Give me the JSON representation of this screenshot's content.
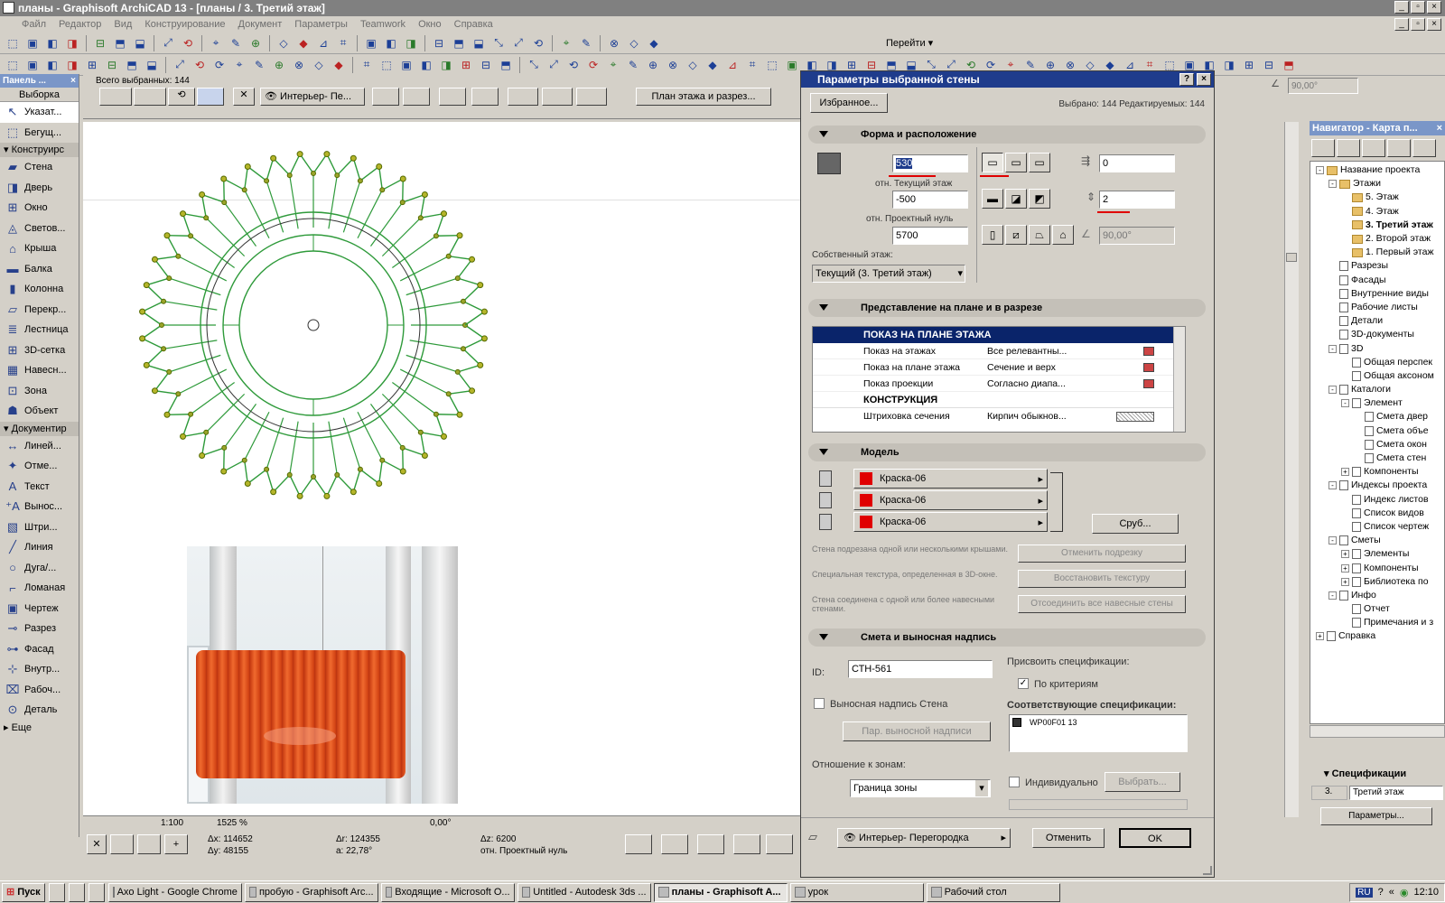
{
  "window": {
    "title": "планы - Graphisoft ArchiCAD 13 - [планы / 3. Третий этаж]"
  },
  "menu": [
    "Файл",
    "Редактор",
    "Вид",
    "Конструирование",
    "Документ",
    "Параметры",
    "Teamwork",
    "Окно",
    "Справка"
  ],
  "toolbar": {
    "goto_label": "Перейти"
  },
  "info_box": {
    "selected_total": "Всего выбранных: 144",
    "view_mode": "Интерьер- Пе...",
    "plan_section": "План этажа и разрез...",
    "angle_value": "90,00°"
  },
  "palette": {
    "title": "Панель ...",
    "tab": "Выборка",
    "items_top": [
      {
        "label": "Указат...",
        "icon": "arrow-icon"
      },
      {
        "label": "Бегущ...",
        "icon": "marquee-icon"
      }
    ],
    "section1": "Конструирс",
    "items_construct": [
      {
        "label": "Стена",
        "icon": "wall-icon"
      },
      {
        "label": "Дверь",
        "icon": "door-icon"
      },
      {
        "label": "Окно",
        "icon": "window-icon"
      },
      {
        "label": "Светов...",
        "icon": "skylight-icon"
      },
      {
        "label": "Крыша",
        "icon": "roof-icon"
      },
      {
        "label": "Балка",
        "icon": "beam-icon"
      },
      {
        "label": "Колонна",
        "icon": "column-icon"
      },
      {
        "label": "Перекр...",
        "icon": "slab-icon"
      },
      {
        "label": "Лестница",
        "icon": "stair-icon"
      },
      {
        "label": "3D-сетка",
        "icon": "mesh-icon"
      },
      {
        "label": "Навесн...",
        "icon": "curtain-wall-icon"
      },
      {
        "label": "Зона",
        "icon": "zone-icon"
      },
      {
        "label": "Объект",
        "icon": "object-icon"
      }
    ],
    "section2": "Документир",
    "items_doc": [
      {
        "label": "Линей...",
        "icon": "dimension-icon"
      },
      {
        "label": "Отме...",
        "icon": "level-icon"
      },
      {
        "label": "Текст",
        "icon": "text-icon"
      },
      {
        "label": "Вынос...",
        "icon": "label-icon"
      },
      {
        "label": "Штри...",
        "icon": "fill-icon"
      },
      {
        "label": "Линия",
        "icon": "line-icon"
      },
      {
        "label": "Дуга/...",
        "icon": "arc-icon"
      },
      {
        "label": "Ломаная",
        "icon": "polyline-icon"
      },
      {
        "label": "Чертеж",
        "icon": "drawing-icon"
      },
      {
        "label": "Разрез",
        "icon": "section-icon"
      },
      {
        "label": "Фасад",
        "icon": "elevation-icon"
      },
      {
        "label": "Внутр...",
        "icon": "interior-icon"
      },
      {
        "label": "Рабоч...",
        "icon": "worksheet-icon"
      },
      {
        "label": "Деталь",
        "icon": "detail-icon"
      }
    ],
    "more": "Еще"
  },
  "statusbar": {
    "scale": "1:100",
    "zoom": "1525 %",
    "angle": "0,00°",
    "dx": "Δx: 114652",
    "dy": "Δy: 48155",
    "dr": "Δr: 124355",
    "a": "a: 22,78°",
    "dz": "Δz: 6200",
    "ref": "отн. Проектный нуль"
  },
  "dialog": {
    "title": "Параметры выбранной стены",
    "favorites": "Избранное...",
    "selection_info": "Выбрано: 144 Редактируемых: 144",
    "sec1": {
      "title": "Форма и расположение",
      "height_top": "530",
      "rel_current": "отн. Текущий этаж",
      "base_offset": "-500",
      "rel_project": "отн. Проектный нуль",
      "total": "5700",
      "home_story_label": "Собственный этаж:",
      "home_story": "Текущий (3. Третий этаж)",
      "offset": "0",
      "thickness": "2",
      "angle": "90,00°"
    },
    "sec2": {
      "title": "Представление на плане и в разрезе",
      "group1": "ПОКАЗ НА ПЛАНЕ ЭТАЖА",
      "rows": [
        {
          "name": "Показ на этажах",
          "value": "Все релевантны..."
        },
        {
          "name": "Показ на плане этажа",
          "value": "Сечение и верх"
        },
        {
          "name": "Показ проекции",
          "value": "Согласно диапа..."
        }
      ],
      "group2": "КОНСТРУКЦИЯ",
      "row_hatch": {
        "name": "Штриховка сечения",
        "value": "Кирпич обыкнов..."
      }
    },
    "sec3": {
      "title": "Модель",
      "surfaces": [
        "Краска-06",
        "Краска-06",
        "Краска-06"
      ],
      "log_btn": "Сруб...",
      "notes": [
        {
          "text": "Стена подрезана одной или несколькими крышами.",
          "btn": "Отменить подрезку"
        },
        {
          "text": "Специальная текстура, определенная в 3D-окне.",
          "btn": "Восстановить текстуру"
        },
        {
          "text": "Стена соединена с одной или более навесными стенами.",
          "btn": "Отсоединить все навесные стены"
        }
      ]
    },
    "sec4": {
      "title": "Смета и выносная надпись",
      "id_label": "ID:",
      "id_value": "СТН-561",
      "assign_label": "Присвоить спецификации:",
      "by_criteria": "По критериям",
      "callout_label": "Выносная надпись Стена",
      "callout_btn": "Пар. выносной надписи",
      "zones_label": "Отношение к зонам:",
      "zones_value": "Граница зоны",
      "matching_label": "Соответствующие спецификации:",
      "matching_item": "WP00F01 13",
      "individual": "Индивидуально",
      "choose_btn": "Выбрать..."
    },
    "layer": "Интерьер- Перегородка",
    "cancel": "Отменить",
    "ok": "OK"
  },
  "navigator": {
    "title": "Навигатор - Карта п...",
    "tree": [
      {
        "label": "Название проекта",
        "lvl": 0,
        "exp": "-",
        "ico": "folder"
      },
      {
        "label": "Этажи",
        "lvl": 1,
        "exp": "-",
        "ico": "folder"
      },
      {
        "label": "5. Этаж",
        "lvl": 2,
        "exp": "",
        "ico": "folder"
      },
      {
        "label": "4. Этаж",
        "lvl": 2,
        "exp": "",
        "ico": "folder"
      },
      {
        "label": "3. Третий этаж",
        "lvl": 2,
        "exp": "",
        "ico": "folder",
        "bold": true
      },
      {
        "label": "2. Второй этаж",
        "lvl": 2,
        "exp": "",
        "ico": "folder"
      },
      {
        "label": "1. Первый этаж",
        "lvl": 2,
        "exp": "",
        "ico": "folder"
      },
      {
        "label": "Разрезы",
        "lvl": 1,
        "exp": "",
        "ico": "doc"
      },
      {
        "label": "Фасады",
        "lvl": 1,
        "exp": "",
        "ico": "doc"
      },
      {
        "label": "Внутренние виды",
        "lvl": 1,
        "exp": "",
        "ico": "doc"
      },
      {
        "label": "Рабочие листы",
        "lvl": 1,
        "exp": "",
        "ico": "doc"
      },
      {
        "label": "Детали",
        "lvl": 1,
        "exp": "",
        "ico": "doc"
      },
      {
        "label": "3D-документы",
        "lvl": 1,
        "exp": "",
        "ico": "doc"
      },
      {
        "label": "3D",
        "lvl": 1,
        "exp": "-",
        "ico": "doc"
      },
      {
        "label": "Общая перспек",
        "lvl": 2,
        "exp": "",
        "ico": "doc"
      },
      {
        "label": "Общая аксоном",
        "lvl": 2,
        "exp": "",
        "ico": "doc"
      },
      {
        "label": "Каталоги",
        "lvl": 1,
        "exp": "-",
        "ico": "doc"
      },
      {
        "label": "Элемент",
        "lvl": 2,
        "exp": "-",
        "ico": "doc"
      },
      {
        "label": "Смета двер",
        "lvl": 3,
        "exp": "",
        "ico": "doc"
      },
      {
        "label": "Смета объе",
        "lvl": 3,
        "exp": "",
        "ico": "doc"
      },
      {
        "label": "Смета окон",
        "lvl": 3,
        "exp": "",
        "ico": "doc"
      },
      {
        "label": "Смета стен",
        "lvl": 3,
        "exp": "",
        "ico": "doc"
      },
      {
        "label": "Компоненты",
        "lvl": 2,
        "exp": "+",
        "ico": "doc"
      },
      {
        "label": "Индексы проекта",
        "lvl": 1,
        "exp": "-",
        "ico": "doc"
      },
      {
        "label": "Индекс листов",
        "lvl": 2,
        "exp": "",
        "ico": "doc"
      },
      {
        "label": "Список видов",
        "lvl": 2,
        "exp": "",
        "ico": "doc"
      },
      {
        "label": "Список чертеж",
        "lvl": 2,
        "exp": "",
        "ico": "doc"
      },
      {
        "label": "Сметы",
        "lvl": 1,
        "exp": "-",
        "ico": "doc"
      },
      {
        "label": "Элементы",
        "lvl": 2,
        "exp": "+",
        "ico": "doc"
      },
      {
        "label": "Компоненты",
        "lvl": 2,
        "exp": "+",
        "ico": "doc"
      },
      {
        "label": "Библиотека по",
        "lvl": 2,
        "exp": "+",
        "ico": "doc"
      },
      {
        "label": "Инфо",
        "lvl": 1,
        "exp": "-",
        "ico": "doc"
      },
      {
        "label": "Отчет",
        "lvl": 2,
        "exp": "",
        "ico": "doc"
      },
      {
        "label": "Примечания и з",
        "lvl": 2,
        "exp": "",
        "ico": "doc"
      },
      {
        "label": "Справка",
        "lvl": 0,
        "exp": "+",
        "ico": "doc"
      }
    ],
    "spec_title": "Спецификации",
    "spec_num": "3.",
    "spec_value": "Третий этаж",
    "params_btn": "Параметры..."
  },
  "taskbar": {
    "start": "Пуск",
    "items": [
      {
        "label": "Axo Light - Google Chrome",
        "active": false
      },
      {
        "label": "пробую - Graphisoft Arc...",
        "active": false
      },
      {
        "label": "Входящие - Microsoft O...",
        "active": false
      },
      {
        "label": "Untitled - Autodesk 3ds ...",
        "active": false
      },
      {
        "label": "планы - Graphisoft A...",
        "active": true
      },
      {
        "label": "урок",
        "active": false
      },
      {
        "label": "Рабочий стол",
        "active": false
      }
    ],
    "lang": "RU",
    "time": "12:10"
  },
  "colors": {
    "title_active": "#1f3c8c",
    "plan_green": "#2e9a3a",
    "red_marker": "#e00000",
    "lamp_orange": "#e3571f"
  }
}
